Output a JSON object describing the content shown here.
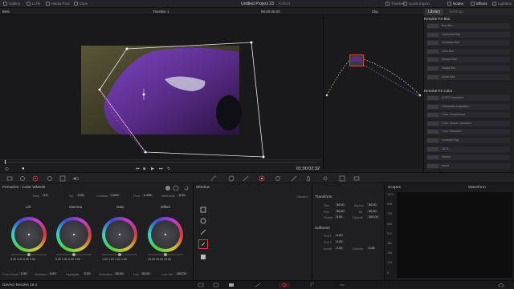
{
  "topbar": {
    "items": [
      "Gallery",
      "LUTs",
      "Media Pool",
      "Clips"
    ],
    "project_title": "Untitled Project 23",
    "edited": "Edited",
    "right_items": [
      "Timeline",
      "Quick Export",
      "Nodes",
      "Effects",
      "Lightbox"
    ]
  },
  "viewer": {
    "zoom": "86%",
    "timeline": "Timeline 1",
    "timecode_top": "00:00:00:00",
    "timecode": "01:00:02:32"
  },
  "nodes": {
    "header": "Clip"
  },
  "library": {
    "tabs": [
      "Library",
      "Settings"
    ],
    "section1": "Resolve FX Blur",
    "blur_items": [
      "Box Blur",
      "Horizontal Blur",
      "Gaussian Blur",
      "Lens Blur",
      "Mosaic Blur",
      "Radial Blur",
      "Zoom Blur"
    ],
    "section2": "Resolve FX Color",
    "color_items": [
      "ACES Transform",
      "Chromatic Adaptation",
      "Color Compressor",
      "Color Space Transform",
      "Color Stabilizer",
      "Contrast Pop",
      "DCTL",
      "Gamut",
      "Invert"
    ]
  },
  "primaries": {
    "title": "Primaries - Color Wheels",
    "temp_label": "Temp",
    "temp": "0.0",
    "tint_label": "Tint",
    "tint": "0.00",
    "contrast_label": "Contrast",
    "contrast": "1.000",
    "pivot_label": "Pivot",
    "pivot": "0.435",
    "mid_label": "Mid/Detail",
    "mid": "0.00",
    "wheels": [
      {
        "name": "Lift",
        "vals": "0.00  0.00  0.00  0.00"
      },
      {
        "name": "Gamma",
        "vals": "0.00  0.00  0.00  0.00"
      },
      {
        "name": "Gain",
        "vals": "1.00  1.00  1.00  1.00"
      },
      {
        "name": "Offset",
        "vals": "25.00  25.00  25.00"
      }
    ],
    "bottom": [
      {
        "label": "Color Boost",
        "value": "0.00"
      },
      {
        "label": "Shadows",
        "value": "0.00"
      },
      {
        "label": "Highlights",
        "value": "0.00"
      },
      {
        "label": "Saturation",
        "value": "50.00"
      },
      {
        "label": "Hue",
        "value": "50.00"
      },
      {
        "label": "Lum Mix",
        "value": "100.00"
      }
    ]
  },
  "window": {
    "title": "Window",
    "col_label": "Gradient"
  },
  "transform": {
    "title": "Transform",
    "size_label": "Size",
    "size": "50.00",
    "aspect_label": "Aspect",
    "aspect": "50.00",
    "pan_label": "Pan",
    "pan": "50.00",
    "tilt_label": "Tilt",
    "tilt": "50.00",
    "rotate_label": "Rotate",
    "rotate": "0.00",
    "opacity_label": "Opacity",
    "opacity": "100.00",
    "softness_title": "Softness",
    "soft1_label": "Soft 1",
    "soft1": "0.00",
    "soft2_label": "Soft 2",
    "soft2": "0.00",
    "inside_label": "Inside",
    "inside": "0.00",
    "outside_label": "Outside",
    "outside": "0.00",
    "soft3": "0.26"
  },
  "scopes": {
    "title": "Scopes",
    "mode": "Waveform",
    "scale": [
      "1023",
      "896",
      "768",
      "640",
      "512",
      "384",
      "256",
      "128",
      "0"
    ]
  },
  "status": {
    "app": "DaVinci Resolve 19.4"
  },
  "colors": {
    "accent": "#e0383e",
    "node": "#e04040",
    "car": "#5b2d8a"
  }
}
